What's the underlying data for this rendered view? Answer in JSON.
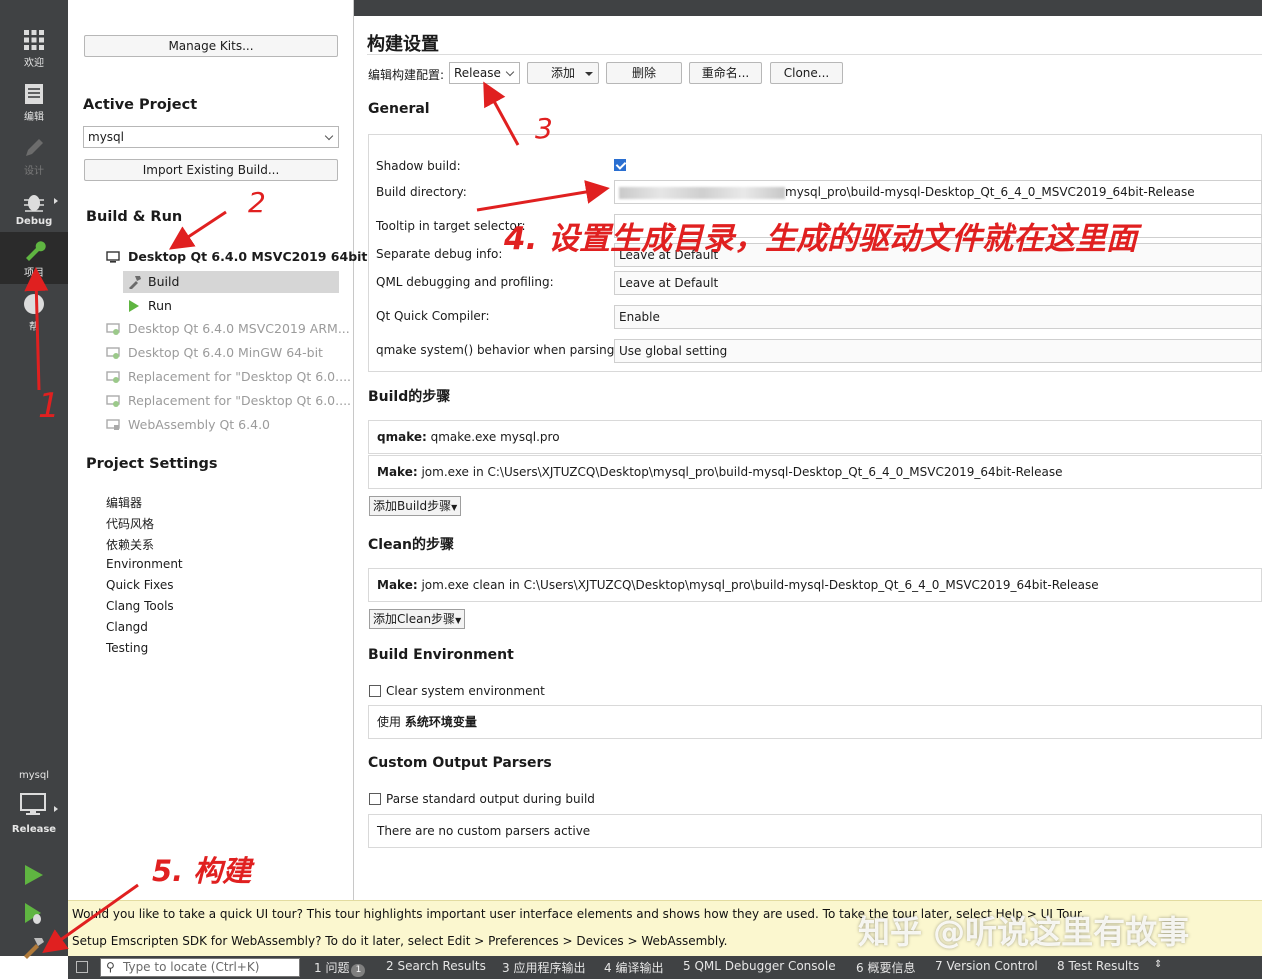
{
  "modes": [
    {
      "label": "欢迎",
      "icon": "grid-icon"
    },
    {
      "label": "编辑",
      "icon": "document-icon"
    },
    {
      "label": "设计",
      "icon": "pencil-icon"
    },
    {
      "label": "Debug",
      "icon": "bug-icon"
    },
    {
      "label": "项目",
      "icon": "wrench-icon"
    },
    {
      "label": "帮",
      "icon": "help-icon"
    }
  ],
  "kit_selector": {
    "project": "mysql",
    "config": "Release"
  },
  "project_pane": {
    "manage_kits": "Manage Kits...",
    "active_project_title": "Active Project",
    "active_project_value": "mysql",
    "import_build": "Import Existing Build...",
    "build_run_title": "Build & Run",
    "kits": [
      {
        "label": "Desktop Qt 6.4.0 MSVC2019 64bit",
        "active": true
      },
      {
        "label": "Build",
        "selected": true
      },
      {
        "label": "Run"
      },
      {
        "label": "Desktop Qt 6.4.0 MSVC2019 ARM..."
      },
      {
        "label": "Desktop Qt 6.4.0 MinGW 64-bit"
      },
      {
        "label": "Replacement for \"Desktop Qt 6.0...."
      },
      {
        "label": "Replacement for \"Desktop Qt 6.0...."
      },
      {
        "label": "WebAssembly Qt 6.4.0"
      }
    ],
    "project_settings_title": "Project Settings",
    "settings": [
      "编辑器",
      "代码风格",
      "依赖关系",
      "Environment",
      "Quick Fixes",
      "Clang Tools",
      "Clangd",
      "Testing"
    ]
  },
  "main": {
    "title": "构建设置",
    "edit_config_label": "编辑构建配置:",
    "config_value": "Release",
    "add_button": "添加",
    "delete_button": "删除",
    "rename_button": "重命名...",
    "clone_button": "Clone...",
    "general_title": "General",
    "shadow_build_label": "Shadow build:",
    "shadow_build_checked": true,
    "build_dir_label": "Build directory:",
    "build_dir_value": "mysql_pro\\build-mysql-Desktop_Qt_6_4_0_MSVC2019_64bit-Release",
    "tooltip_label": "Tooltip in target selector:",
    "sep_debug_label": "Separate debug info:",
    "sep_debug_value": "Leave at Default",
    "qml_debug_label": "QML debugging and profiling:",
    "qml_debug_value": "Leave at Default",
    "qt_quick_label": "Qt Quick Compiler:",
    "qt_quick_value": "Enable",
    "qmake_system_label": "qmake system() behavior when parsing:",
    "qmake_system_value": "Use global setting",
    "build_steps_title": "Build的步骤",
    "qmake_step_key": "qmake:",
    "qmake_step_value": "qmake.exe mysql.pro",
    "make_step_key": "Make:",
    "make_step_value": "jom.exe in C:\\Users\\XJTUZCQ\\Desktop\\mysql_pro\\build-mysql-Desktop_Qt_6_4_0_MSVC2019_64bit-Release",
    "add_build_step": "添加Build步骤",
    "clean_steps_title": "Clean的步骤",
    "clean_step_key": "Make:",
    "clean_step_value": "jom.exe clean in C:\\Users\\XJTUZCQ\\Desktop\\mysql_pro\\build-mysql-Desktop_Qt_6_4_0_MSVC2019_64bit-Release",
    "add_clean_step": "添加Clean步骤",
    "build_env_title": "Build Environment",
    "clear_env_label": "Clear system environment",
    "use_env_prefix": "使用",
    "use_env_value": "系统环境变量",
    "custom_parsers_title": "Custom Output Parsers",
    "parse_output_label": "Parse standard output during build",
    "no_parsers": "There are no custom parsers active"
  },
  "notifications": [
    "Would you like to take a quick UI tour? This tour highlights important user interface elements and shows how they are used. To take the tour later, select Help > UI Tour.",
    "Setup Emscripten SDK for WebAssembly? To do it later, select Edit > Preferences > Devices > WebAssembly."
  ],
  "statusbar": {
    "locate_placeholder": "Type to locate (Ctrl+K)",
    "tabs": [
      {
        "label": "1 问题",
        "badge": "1"
      },
      {
        "label": "2 Search Results"
      },
      {
        "label": "3 应用程序输出"
      },
      {
        "label": "4 编译输出"
      },
      {
        "label": "5 QML Debugger Console"
      },
      {
        "label": "6 概要信息"
      },
      {
        "label": "7 Version Control"
      },
      {
        "label": "8 Test Results"
      }
    ]
  },
  "annotations": {
    "n1": "1",
    "n2": "2",
    "n3": "3",
    "n4": "4. 设置生成目录，生成的驱动文件就在这里面",
    "n5": "5. 构建"
  },
  "watermark": "知乎 @听说这里有故事",
  "colors": {
    "accent": "#2a6fd1",
    "annotation": "#e02020",
    "dark_bar": "#404244",
    "notice_bg": "#fbf7cf"
  }
}
